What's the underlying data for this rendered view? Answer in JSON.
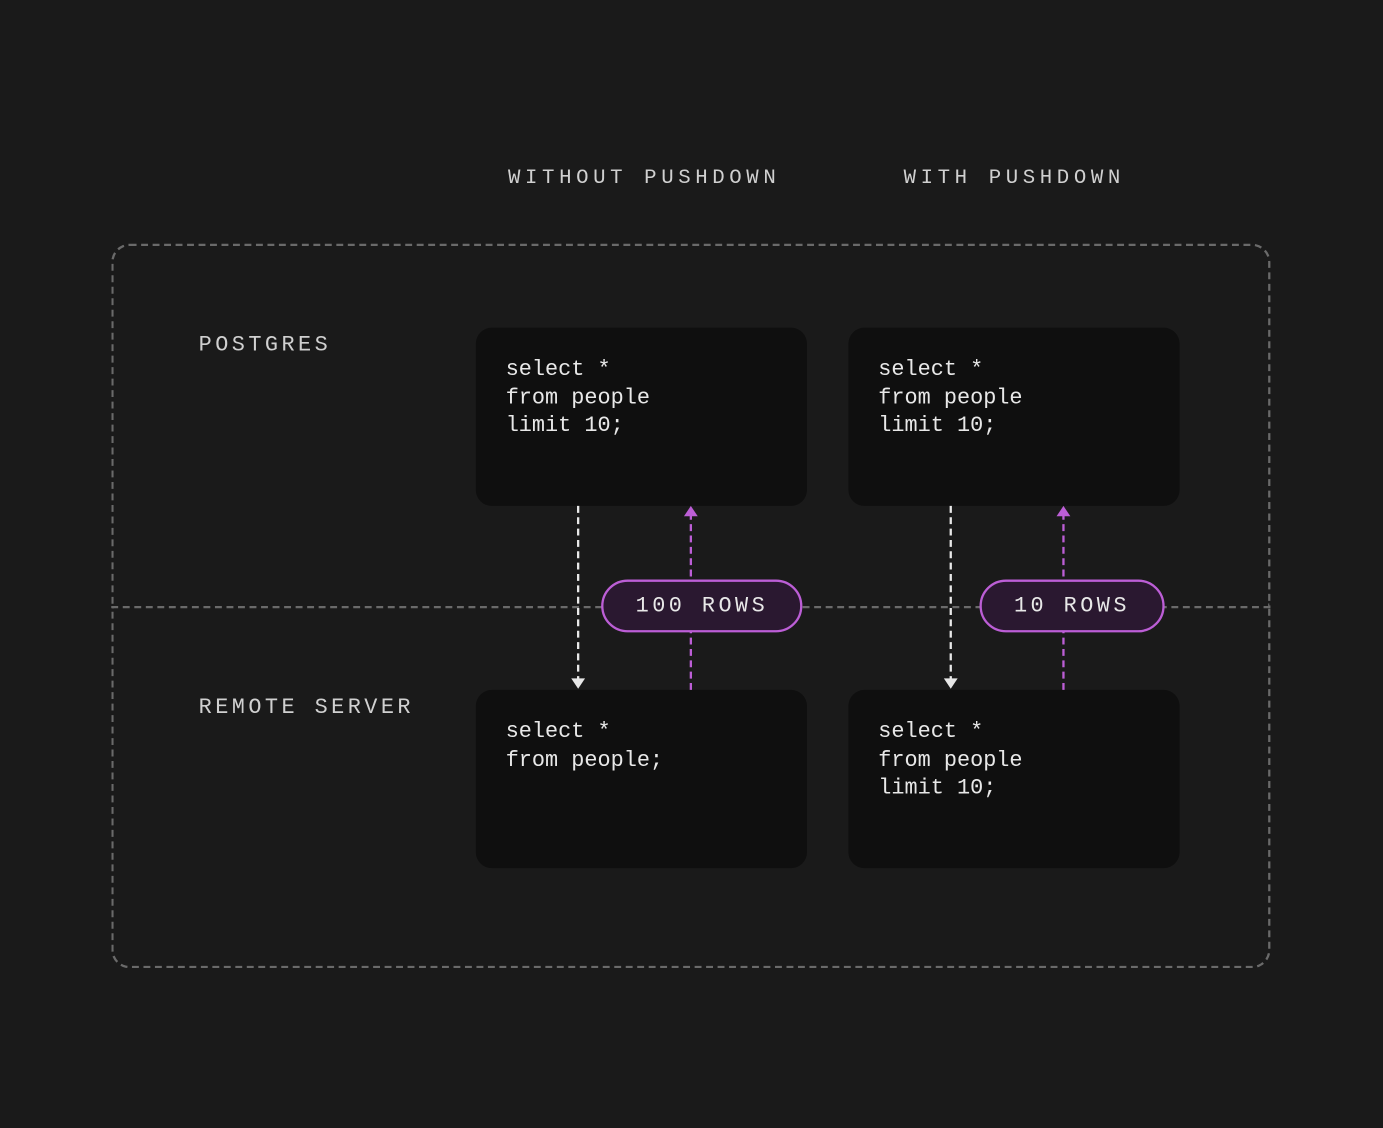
{
  "headers": {
    "without": "WITHOUT PUSHDOWN",
    "with": "WITH PUSHDOWN"
  },
  "zones": {
    "postgres": "POSTGRES",
    "remote": "REMOTE SERVER"
  },
  "queries": {
    "postgres_without": "select *\nfrom people\nlimit 10;",
    "postgres_with": "select *\nfrom people\nlimit 10;",
    "remote_without": "select *\nfrom people;",
    "remote_with": "select *\nfrom people\nlimit 10;"
  },
  "pills": {
    "without_rows": "100 ROWS",
    "with_rows": "10 ROWS"
  },
  "colors": {
    "background": "#1a1a1a",
    "card_background": "#0f0f0f",
    "text": "#e8e8e8",
    "dash": "#6a6a6a",
    "accent_purple": "#bc5ed6"
  }
}
